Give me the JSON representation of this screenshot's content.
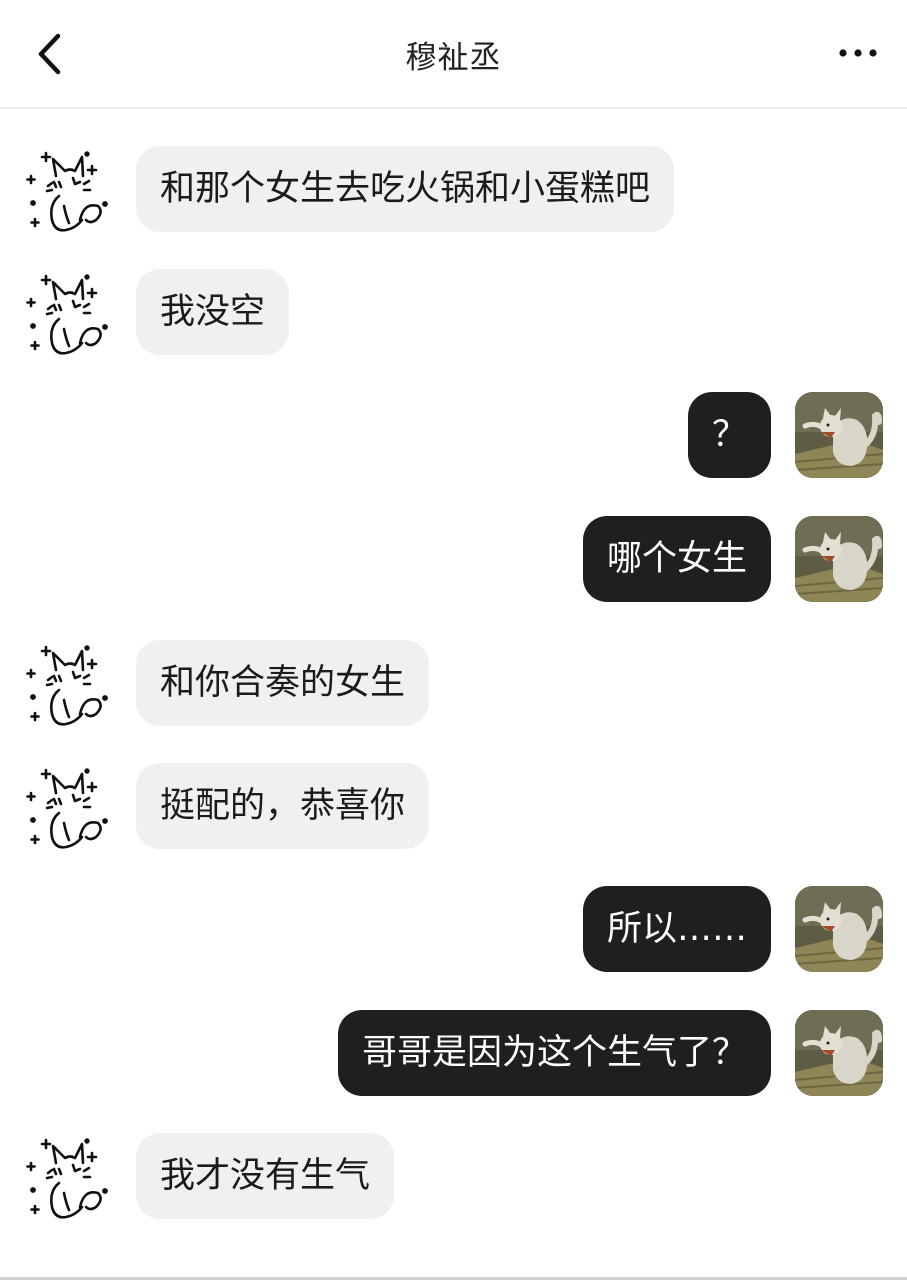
{
  "header": {
    "title": "穆祉丞",
    "back_icon": "chevron-left-icon",
    "more_icon": "more-dots-icon"
  },
  "avatars": {
    "incoming": "doodle-cat-avatar",
    "outgoing": "painted-cat-avatar"
  },
  "colors": {
    "incoming_bubble": "#f0f0f0",
    "outgoing_bubble": "#1f1f1f",
    "outgoing_text": "#ffffff"
  },
  "messages": [
    {
      "side": "in",
      "text": "和那个女生去吃火锅和小蛋糕吧"
    },
    {
      "side": "in",
      "text": "我没空"
    },
    {
      "side": "out",
      "text": "？"
    },
    {
      "side": "out",
      "text": "哪个女生"
    },
    {
      "side": "in",
      "text": "和你合奏的女生"
    },
    {
      "side": "in",
      "text": "挺配的，恭喜你"
    },
    {
      "side": "out",
      "text": "所以……"
    },
    {
      "side": "out",
      "text": "哥哥是因为这个生气了？"
    },
    {
      "side": "in",
      "text": "我才没有生气"
    }
  ]
}
